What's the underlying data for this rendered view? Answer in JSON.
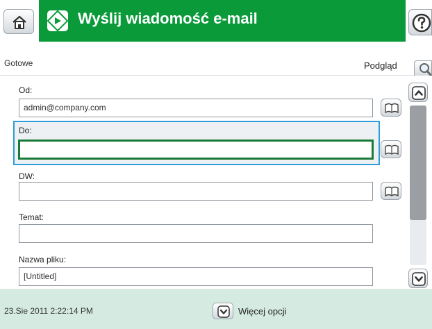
{
  "header": {
    "title": "Wyślij wiadomość e-mail"
  },
  "status": {
    "text": "Gotowe",
    "preview_label": "Podgląd"
  },
  "form": {
    "od": {
      "label": "Od:",
      "value": "admin@company.com"
    },
    "do": {
      "label": "Do:",
      "value": ""
    },
    "dw": {
      "label": "DW:",
      "value": ""
    },
    "temat": {
      "label": "Temat:",
      "value": ""
    },
    "nazwa_pliku": {
      "label": "Nazwa pliku:",
      "value": "[Untitled]"
    }
  },
  "footer": {
    "datetime": "23.Sie 2011 2:22:14 PM",
    "more_options": "Więcej opcji"
  },
  "colors": {
    "title_bar": "#0a9a3a",
    "focus_border": "#2d9ddb",
    "active_input_border": "#1a7a3a",
    "footer_bg": "#d5ebe2"
  },
  "icons": {
    "home": "home-icon",
    "scan_send": "send-icon",
    "help": "help-icon",
    "preview": "magnifier-icon",
    "address_book": "address-book-icon",
    "scroll_up": "chevron-up-icon",
    "scroll_down": "chevron-down-icon",
    "more_options": "chevron-down-icon"
  }
}
